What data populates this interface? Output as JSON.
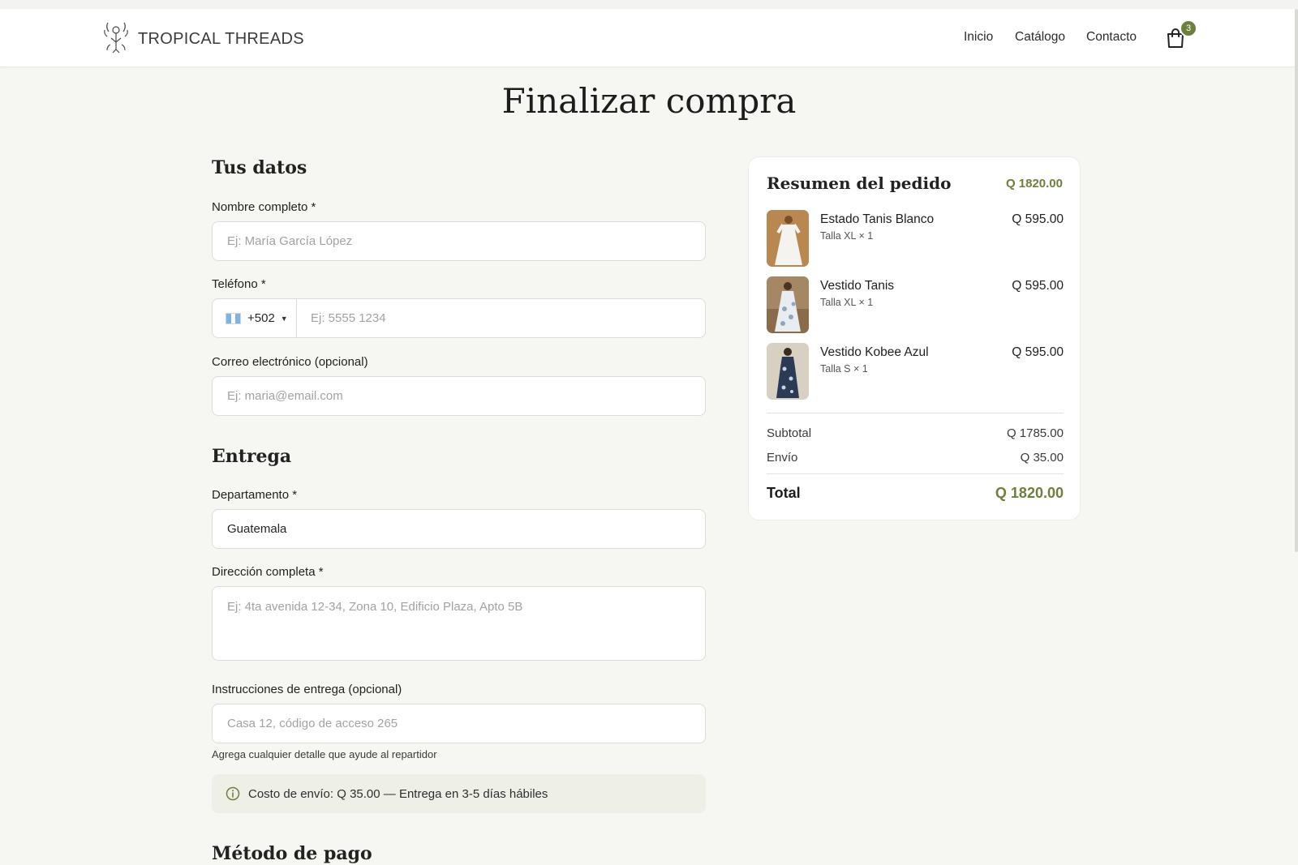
{
  "header": {
    "brand": "TROPICAL THREADS",
    "nav": [
      "Inicio",
      "Catálogo",
      "Contacto"
    ],
    "cart_count": "3"
  },
  "page_title": "Finalizar compra",
  "form": {
    "section_personal": "Tus datos",
    "name_label": "Nombre completo *",
    "name_placeholder": "Ej: María García López",
    "phone_label": "Teléfono *",
    "phone_code": "+502",
    "phone_placeholder": "Ej: 5555 1234",
    "email_label": "Correo electrónico (opcional)",
    "email_placeholder": "Ej: maria@email.com",
    "section_delivery": "Entrega",
    "department_label": "Departamento *",
    "department_value": "Guatemala",
    "address_label": "Dirección completa *",
    "address_placeholder": "Ej: 4ta avenida 12-34, Zona 10, Edificio Plaza, Apto 5B",
    "instructions_label": "Instrucciones de entrega (opcional)",
    "instructions_placeholder": "Casa 12, código de acceso 265",
    "instructions_help": "Agrega cualquier detalle que ayude al repartidor",
    "shipping_info": "Costo de envío: Q 35.00 — Entrega en 3-5 días hábiles",
    "section_payment": "Método de pago"
  },
  "summary": {
    "title": "Resumen del pedido",
    "total_top": "Q 1820.00",
    "items": [
      {
        "name": "Estado Tanis Blanco",
        "meta": "Talla XL × 1",
        "price": "Q 595.00"
      },
      {
        "name": "Vestido Tanis",
        "meta": "Talla XL × 1",
        "price": "Q 595.00"
      },
      {
        "name": "Vestido Kobee Azul",
        "meta": "Talla S × 1",
        "price": "Q 595.00"
      }
    ],
    "subtotal_label": "Subtotal",
    "subtotal_value": "Q 1785.00",
    "shipping_label": "Envío",
    "shipping_value": "Q 35.00",
    "total_label": "Total",
    "total_value": "Q 1820.00"
  },
  "colors": {
    "accent": "#6e7f3d",
    "background": "#f6f6f3",
    "card": "#ffffff"
  }
}
